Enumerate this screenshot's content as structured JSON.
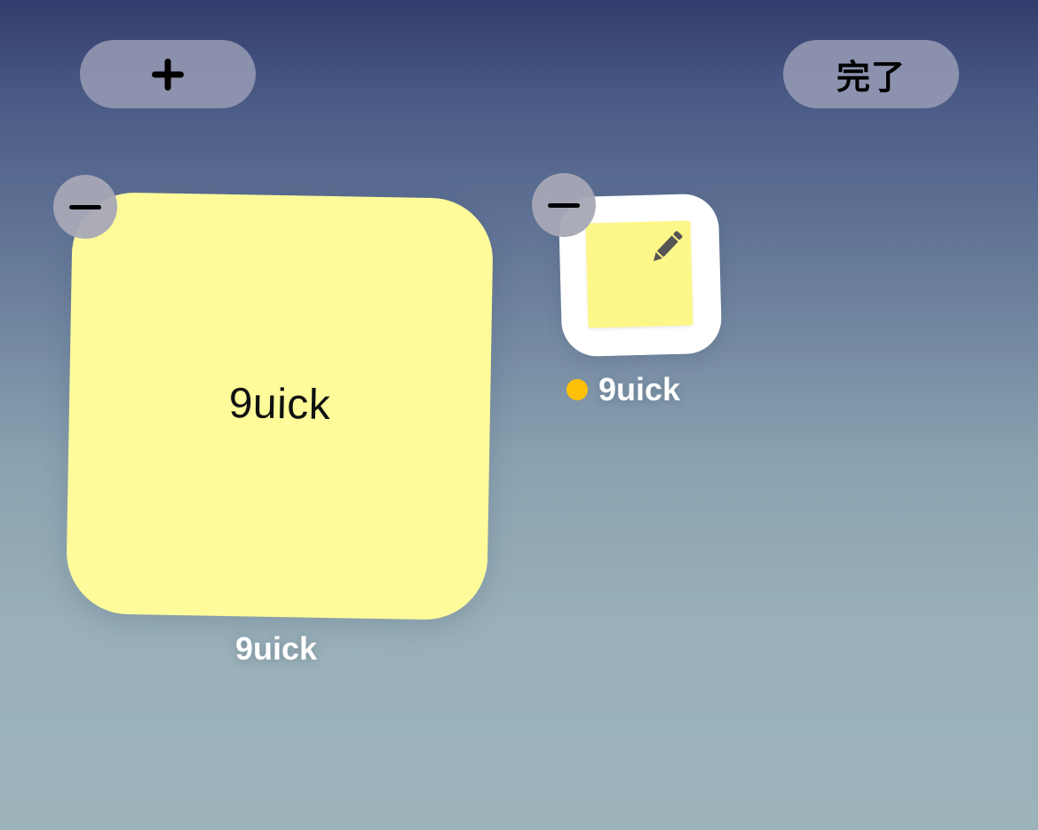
{
  "toolbar": {
    "add_icon": "plus-icon",
    "done_label": "完了"
  },
  "widget": {
    "note_text": "9uick",
    "label": "9uick",
    "color": "#fffb9b",
    "remove_icon": "minus-icon"
  },
  "app": {
    "label": "9uick",
    "icon": "notes-pencil-icon",
    "new_indicator_color": "#ffc107",
    "remove_icon": "minus-icon"
  }
}
